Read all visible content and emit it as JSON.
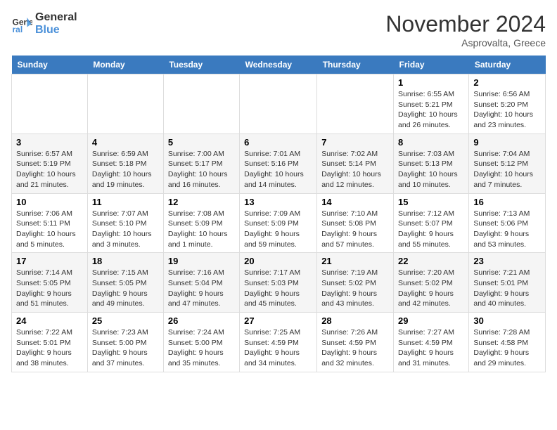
{
  "logo": {
    "line1": "General",
    "line2": "Blue"
  },
  "title": "November 2024",
  "location": "Asprovalta, Greece",
  "days_of_week": [
    "Sunday",
    "Monday",
    "Tuesday",
    "Wednesday",
    "Thursday",
    "Friday",
    "Saturday"
  ],
  "weeks": [
    [
      {
        "day": "",
        "info": ""
      },
      {
        "day": "",
        "info": ""
      },
      {
        "day": "",
        "info": ""
      },
      {
        "day": "",
        "info": ""
      },
      {
        "day": "",
        "info": ""
      },
      {
        "day": "1",
        "info": "Sunrise: 6:55 AM\nSunset: 5:21 PM\nDaylight: 10 hours and 26 minutes."
      },
      {
        "day": "2",
        "info": "Sunrise: 6:56 AM\nSunset: 5:20 PM\nDaylight: 10 hours and 23 minutes."
      }
    ],
    [
      {
        "day": "3",
        "info": "Sunrise: 6:57 AM\nSunset: 5:19 PM\nDaylight: 10 hours and 21 minutes."
      },
      {
        "day": "4",
        "info": "Sunrise: 6:59 AM\nSunset: 5:18 PM\nDaylight: 10 hours and 19 minutes."
      },
      {
        "day": "5",
        "info": "Sunrise: 7:00 AM\nSunset: 5:17 PM\nDaylight: 10 hours and 16 minutes."
      },
      {
        "day": "6",
        "info": "Sunrise: 7:01 AM\nSunset: 5:16 PM\nDaylight: 10 hours and 14 minutes."
      },
      {
        "day": "7",
        "info": "Sunrise: 7:02 AM\nSunset: 5:14 PM\nDaylight: 10 hours and 12 minutes."
      },
      {
        "day": "8",
        "info": "Sunrise: 7:03 AM\nSunset: 5:13 PM\nDaylight: 10 hours and 10 minutes."
      },
      {
        "day": "9",
        "info": "Sunrise: 7:04 AM\nSunset: 5:12 PM\nDaylight: 10 hours and 7 minutes."
      }
    ],
    [
      {
        "day": "10",
        "info": "Sunrise: 7:06 AM\nSunset: 5:11 PM\nDaylight: 10 hours and 5 minutes."
      },
      {
        "day": "11",
        "info": "Sunrise: 7:07 AM\nSunset: 5:10 PM\nDaylight: 10 hours and 3 minutes."
      },
      {
        "day": "12",
        "info": "Sunrise: 7:08 AM\nSunset: 5:09 PM\nDaylight: 10 hours and 1 minute."
      },
      {
        "day": "13",
        "info": "Sunrise: 7:09 AM\nSunset: 5:09 PM\nDaylight: 9 hours and 59 minutes."
      },
      {
        "day": "14",
        "info": "Sunrise: 7:10 AM\nSunset: 5:08 PM\nDaylight: 9 hours and 57 minutes."
      },
      {
        "day": "15",
        "info": "Sunrise: 7:12 AM\nSunset: 5:07 PM\nDaylight: 9 hours and 55 minutes."
      },
      {
        "day": "16",
        "info": "Sunrise: 7:13 AM\nSunset: 5:06 PM\nDaylight: 9 hours and 53 minutes."
      }
    ],
    [
      {
        "day": "17",
        "info": "Sunrise: 7:14 AM\nSunset: 5:05 PM\nDaylight: 9 hours and 51 minutes."
      },
      {
        "day": "18",
        "info": "Sunrise: 7:15 AM\nSunset: 5:05 PM\nDaylight: 9 hours and 49 minutes."
      },
      {
        "day": "19",
        "info": "Sunrise: 7:16 AM\nSunset: 5:04 PM\nDaylight: 9 hours and 47 minutes."
      },
      {
        "day": "20",
        "info": "Sunrise: 7:17 AM\nSunset: 5:03 PM\nDaylight: 9 hours and 45 minutes."
      },
      {
        "day": "21",
        "info": "Sunrise: 7:19 AM\nSunset: 5:02 PM\nDaylight: 9 hours and 43 minutes."
      },
      {
        "day": "22",
        "info": "Sunrise: 7:20 AM\nSunset: 5:02 PM\nDaylight: 9 hours and 42 minutes."
      },
      {
        "day": "23",
        "info": "Sunrise: 7:21 AM\nSunset: 5:01 PM\nDaylight: 9 hours and 40 minutes."
      }
    ],
    [
      {
        "day": "24",
        "info": "Sunrise: 7:22 AM\nSunset: 5:01 PM\nDaylight: 9 hours and 38 minutes."
      },
      {
        "day": "25",
        "info": "Sunrise: 7:23 AM\nSunset: 5:00 PM\nDaylight: 9 hours and 37 minutes."
      },
      {
        "day": "26",
        "info": "Sunrise: 7:24 AM\nSunset: 5:00 PM\nDaylight: 9 hours and 35 minutes."
      },
      {
        "day": "27",
        "info": "Sunrise: 7:25 AM\nSunset: 4:59 PM\nDaylight: 9 hours and 34 minutes."
      },
      {
        "day": "28",
        "info": "Sunrise: 7:26 AM\nSunset: 4:59 PM\nDaylight: 9 hours and 32 minutes."
      },
      {
        "day": "29",
        "info": "Sunrise: 7:27 AM\nSunset: 4:59 PM\nDaylight: 9 hours and 31 minutes."
      },
      {
        "day": "30",
        "info": "Sunrise: 7:28 AM\nSunset: 4:58 PM\nDaylight: 9 hours and 29 minutes."
      }
    ]
  ]
}
